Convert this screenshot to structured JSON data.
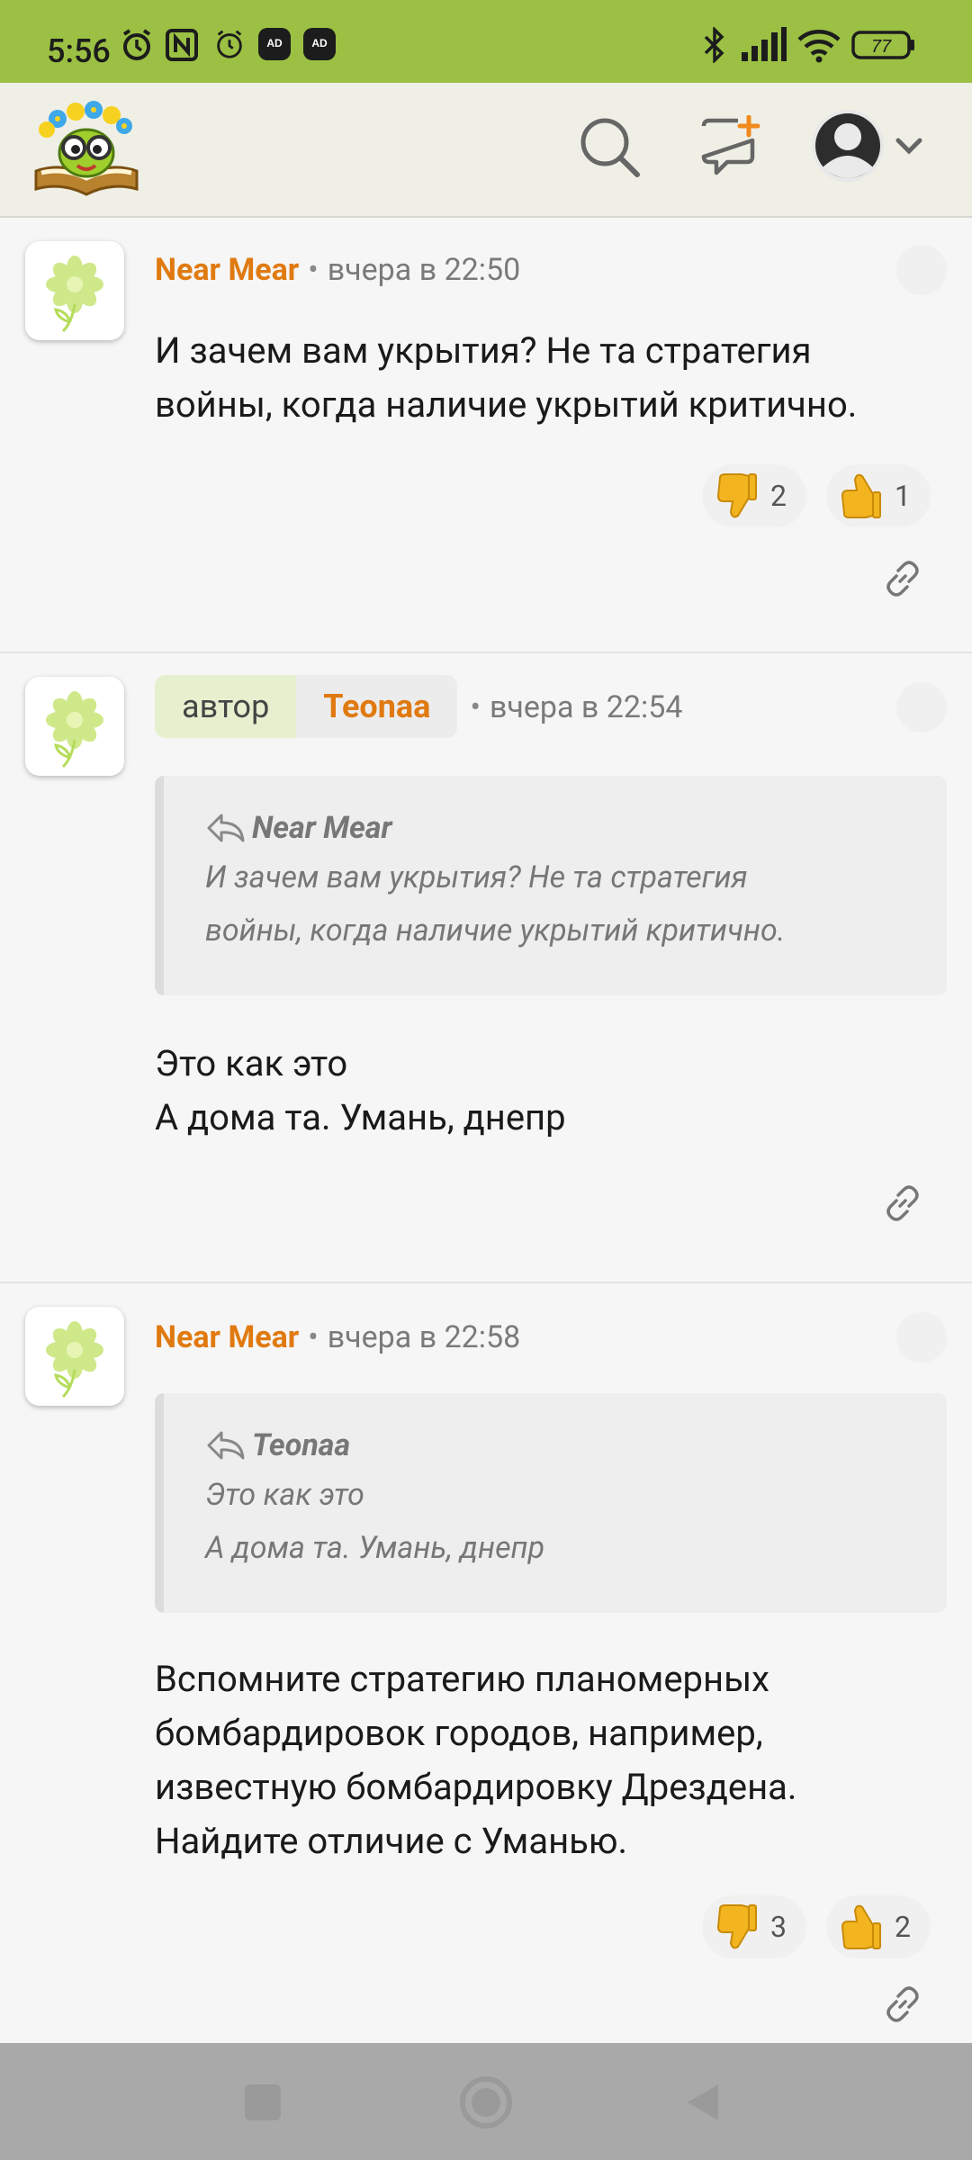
{
  "status_bar": {
    "time": "5:56",
    "battery": "77",
    "icons": [
      "alarm-icon",
      "nfc-icon",
      "alarm-clock-icon",
      "ad-blocker-icon",
      "ad-blocker-icon",
      "bluetooth-icon",
      "signal-icon",
      "wifi-icon",
      "battery-icon"
    ],
    "ad_label": "AD"
  },
  "header": {
    "icons": [
      "logo",
      "search-icon",
      "new-post-icon",
      "profile-icon",
      "chevron-down-icon"
    ]
  },
  "comments": [
    {
      "author": "Near Mear",
      "separator": "•",
      "time": "вчера в 22:50",
      "text_lines": [
        "И зачем вам укрытия? Не та стратегия",
        "войны, когда наличие укрытий критично."
      ],
      "dislikes": "2",
      "likes": "1"
    },
    {
      "author_tag": "автор",
      "author": "Teonaa",
      "separator": "•",
      "time": "вчера в 22:54",
      "quote_author": "Near Mear",
      "quote_lines": [
        "И зачем вам укрытия? Не та стратегия",
        "войны, когда наличие укрытий критично."
      ],
      "text_lines": [
        "Это как это",
        "А дома та. Умань, днепр"
      ]
    },
    {
      "author": "Near Mear",
      "separator": "•",
      "time": "вчера в 22:58",
      "quote_author": "Teonaa",
      "quote_lines": [
        "Это как это",
        "А дома та. Умань, днепр"
      ],
      "text_lines": [
        "Вспомните стратегию планомерных",
        "бомбардировок городов, например,",
        "известную бомбардировку Дрездена.",
        "Найдите отличие с Уманью."
      ],
      "dislikes": "3",
      "likes": "2"
    }
  ],
  "nav": {
    "icons": [
      "recents-icon",
      "home-icon",
      "back-icon"
    ]
  },
  "colors": {
    "status_bar": "#9bc043",
    "author": "#e07a10",
    "author_tag_bg": "#e6f0cf",
    "thumb": "#f2b51f"
  }
}
